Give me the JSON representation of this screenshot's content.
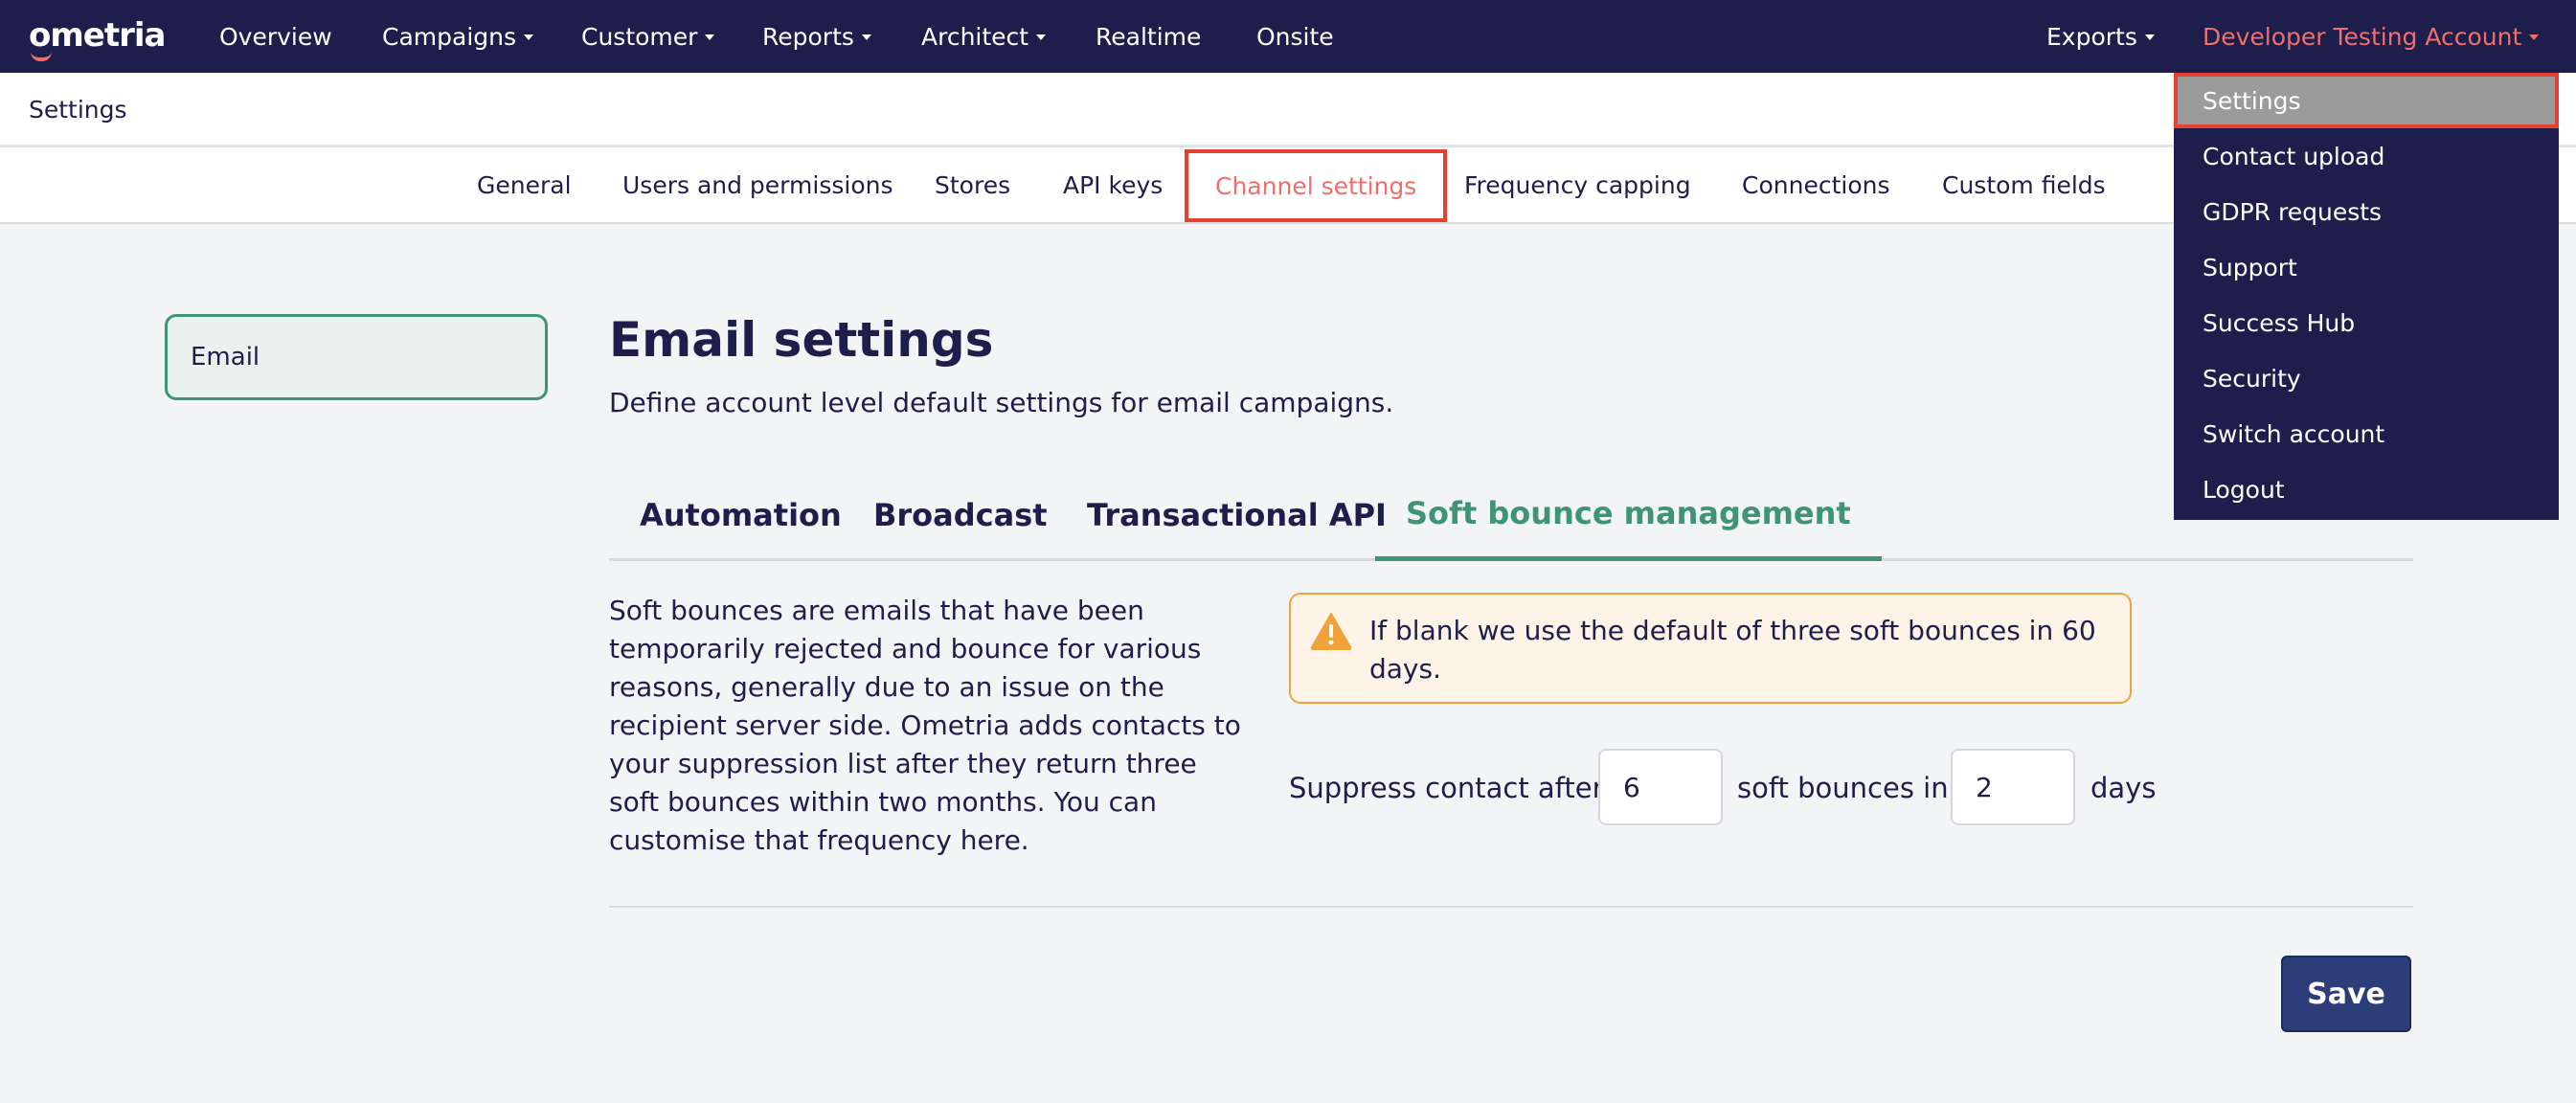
{
  "app": {
    "logo_text": "ometria"
  },
  "topnav": {
    "items": [
      {
        "label": "Overview"
      },
      {
        "label": "Campaigns"
      },
      {
        "label": "Customer"
      },
      {
        "label": "Reports"
      },
      {
        "label": "Architect"
      },
      {
        "label": "Realtime"
      },
      {
        "label": "Onsite"
      }
    ],
    "exports_label": "Exports",
    "account_label": "Developer Testing Account"
  },
  "subheader": {
    "title": "Settings"
  },
  "settings_tabs": [
    {
      "label": "General"
    },
    {
      "label": "Users and permissions"
    },
    {
      "label": "Stores"
    },
    {
      "label": "API keys"
    },
    {
      "label": "Channel settings",
      "active": true
    },
    {
      "label": "Frequency capping"
    },
    {
      "label": "Connections"
    },
    {
      "label": "Custom fields"
    }
  ],
  "sidenav": {
    "items": [
      {
        "label": "Email",
        "active": true
      }
    ]
  },
  "main": {
    "title": "Email settings",
    "subtitle": "Define account level default settings for email campaigns.",
    "tabs": [
      {
        "label": "Automation"
      },
      {
        "label": "Broadcast"
      },
      {
        "label": "Transactional API"
      },
      {
        "label": "Soft bounce management",
        "active": true
      }
    ],
    "description": "Soft bounces are emails that have been temporarily rejected and bounce for various reasons, generally due to an issue on the recipient server side. Ometria adds contacts to your suppression list after they return three soft bounces within two months. You can customise that frequency here.",
    "alert": {
      "icon": "warning-icon",
      "text": "If blank we use the default of three soft bounces in 60 days."
    },
    "suppress": {
      "label_before": "Suppress contact after",
      "bounces_value": "6",
      "label_middle": "soft bounces in",
      "days_value": "2",
      "label_after": "days"
    },
    "save_label": "Save"
  },
  "dropdown": {
    "items": [
      {
        "label": "Settings",
        "active": true
      },
      {
        "label": "Contact upload"
      },
      {
        "label": "GDPR requests"
      },
      {
        "label": "Support"
      },
      {
        "label": "Success Hub"
      },
      {
        "label": "Security"
      },
      {
        "label": "Switch account"
      },
      {
        "label": "Logout"
      }
    ]
  },
  "colors": {
    "nav_bg": "#1d1e4b",
    "accent_coral": "#ef6f6c",
    "highlight_red": "#e5412f",
    "green": "#3f9478",
    "save_bg": "#2d3d7a",
    "alert_bg": "#fdf3e6",
    "alert_border": "#f0a33a"
  }
}
